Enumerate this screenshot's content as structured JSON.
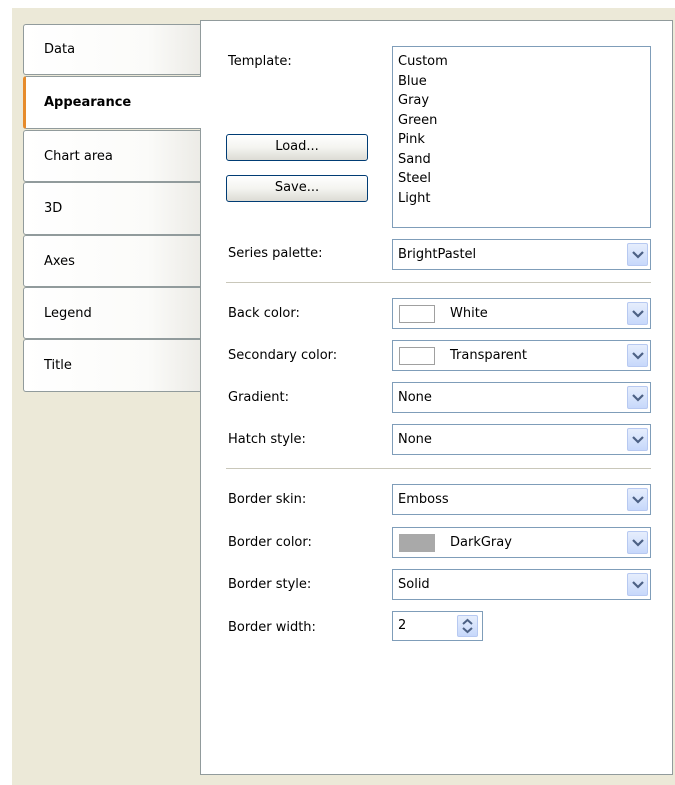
{
  "tabs": [
    {
      "label": "Data",
      "selected": false
    },
    {
      "label": "Appearance",
      "selected": true
    },
    {
      "label": "Chart area",
      "selected": false
    },
    {
      "label": "3D",
      "selected": false
    },
    {
      "label": "Axes",
      "selected": false
    },
    {
      "label": "Legend",
      "selected": false
    },
    {
      "label": "Title",
      "selected": false
    }
  ],
  "template": {
    "label": "Template:",
    "options": [
      "Custom",
      "Blue",
      "Gray",
      "Green",
      "Pink",
      "Sand",
      "Steel",
      "Light"
    ],
    "load_label": "Load...",
    "save_label": "Save..."
  },
  "series_palette": {
    "label": "Series palette:",
    "value": "BrightPastel"
  },
  "back_color": {
    "label": "Back color:",
    "value": "White",
    "swatch": "#ffffff"
  },
  "secondary_color": {
    "label": "Secondary color:",
    "value": "Transparent",
    "swatch": "#ffffff"
  },
  "gradient": {
    "label": "Gradient:",
    "value": "None"
  },
  "hatch_style": {
    "label": "Hatch style:",
    "value": "None"
  },
  "border_skin": {
    "label": "Border skin:",
    "value": "Emboss"
  },
  "border_color": {
    "label": "Border color:",
    "value": "DarkGray",
    "swatch": "#a9a9a9"
  },
  "border_style": {
    "label": "Border style:",
    "value": "Solid"
  },
  "border_width": {
    "label": "Border width:",
    "value": "2"
  },
  "colors": {
    "selected_tab_accent": "#e68b2c",
    "dialog_background": "#ece9d8",
    "control_border": "#7f9db9"
  }
}
